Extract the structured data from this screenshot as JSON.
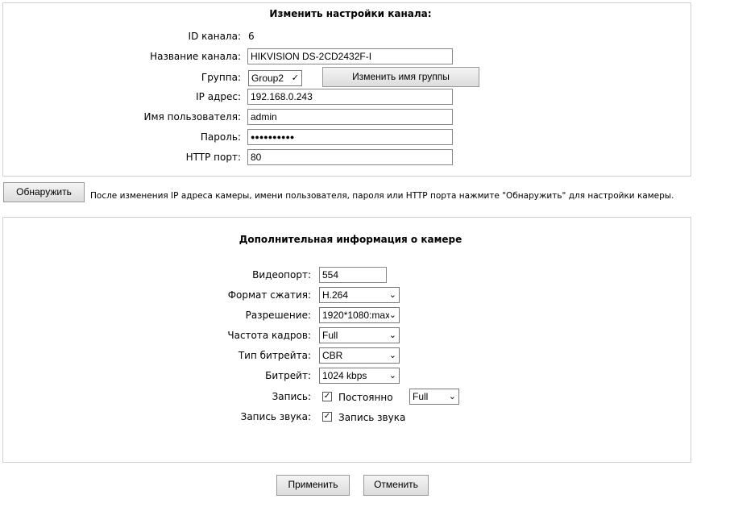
{
  "channel": {
    "title": "Изменить настройки канала:",
    "id_label": "ID канала:",
    "id_value": "6",
    "name_label": "Название канала:",
    "name_value": "HIKVISION DS-2CD2432F-I",
    "group_label": "Группа:",
    "group_value": "Group2",
    "rename_group_button": "Изменить имя группы",
    "ip_label": "IP адрес:",
    "ip_value": "192.168.0.243",
    "user_label": "Имя пользователя:",
    "user_value": "admin",
    "password_label": "Пароль:",
    "password_value": "●●●●●●●●●●",
    "port_label": "HTTP порт:",
    "port_value": "80"
  },
  "detect": {
    "button": "Обнаружить",
    "hint": "После изменения IP адреса камеры, имени пользователя, пароля или HTTP порта нажмите \"Обнаружить\" для настройки камеры."
  },
  "camera": {
    "title": "Дополнительная информация о камере",
    "videoport_label": "Видеопорт:",
    "videoport_value": "554",
    "codec_label": "Формат сжатия:",
    "codec_value": "H.264",
    "resolution_label": "Разрешение:",
    "resolution_value": "1920*1080:max",
    "fps_label": "Частота кадров:",
    "fps_value": "Full",
    "bitrate_type_label": "Тип битрейта:",
    "bitrate_type_value": "CBR",
    "bitrate_label": "Битрейт:",
    "bitrate_value": "1024 kbps",
    "record_label": "Запись:",
    "record_checkbox": "Постоянно",
    "record_checked": true,
    "record_quality": "Full",
    "audio_label": "Запись звука:",
    "audio_checkbox": "Запись звука",
    "audio_checked": true
  },
  "actions": {
    "apply": "Применить",
    "cancel": "Отменить"
  }
}
